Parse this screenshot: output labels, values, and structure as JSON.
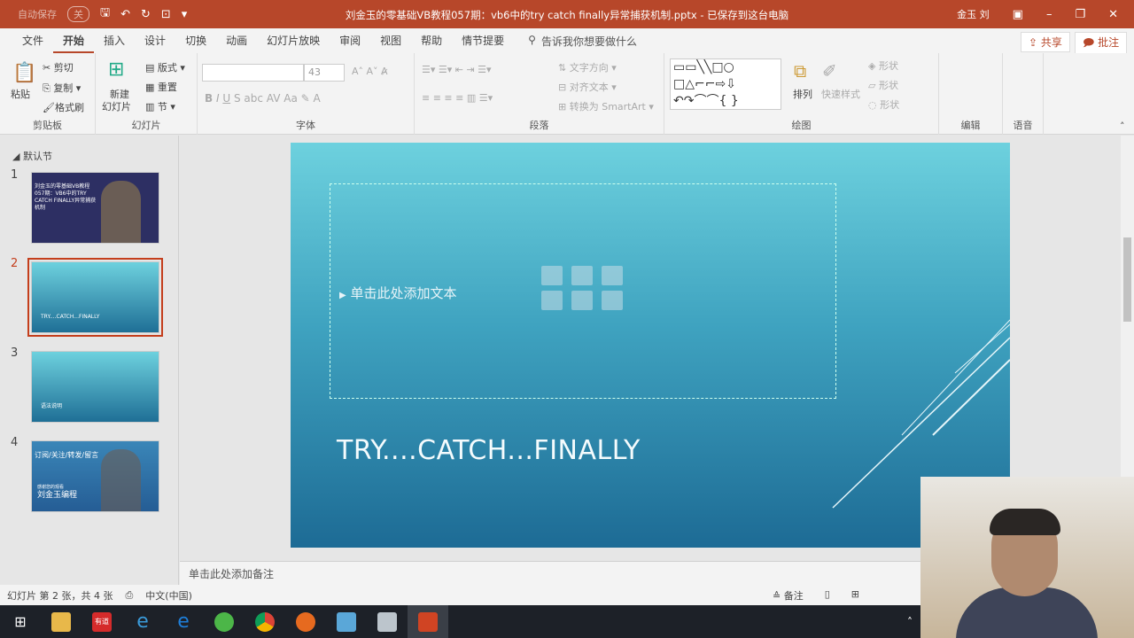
{
  "titlebar": {
    "autosave": "自动保存",
    "autosave_state": "关",
    "title": "刘金玉的零基础VB教程057期：vb6中的try catch finally异常捕获机制.pptx - 已保存到这台电脑",
    "user": "金玉 刘"
  },
  "menu": {
    "tabs": [
      "文件",
      "开始",
      "插入",
      "设计",
      "切换",
      "动画",
      "幻灯片放映",
      "审阅",
      "视图",
      "帮助",
      "情节提要"
    ],
    "active": "开始",
    "tell_me": "告诉我你想要做什么",
    "share": "共享",
    "comments": "批注"
  },
  "ribbon": {
    "clipboard": {
      "label": "剪贴板",
      "paste": "粘贴",
      "cut": "剪切",
      "copy": "复制",
      "format_painter": "格式刷"
    },
    "slides": {
      "label": "幻灯片",
      "new_slide": "新建",
      "new_slide2": "幻灯片",
      "layout": "版式",
      "reset": "重置",
      "section": "节"
    },
    "font": {
      "label": "字体",
      "font_name": "",
      "font_size": "43"
    },
    "paragraph": {
      "label": "段落",
      "text_direction": "文字方向",
      "align_text": "对齐文本",
      "smartart": "转换为 SmartArt"
    },
    "drawing": {
      "label": "绘图",
      "arrange": "排列",
      "quick_styles": "快速样式",
      "shape_fill": "形状",
      "shape_outline": "形状",
      "shape_effects": "形状"
    },
    "editing": {
      "label": "编辑"
    },
    "voice": {
      "label": "语音"
    }
  },
  "slides_pane": {
    "section": "默认节",
    "slides": [
      {
        "num": "1",
        "text": "刘金玉的零基础VB教程057期：VB6中的TRY CATCH FINALLY异常捕获机制"
      },
      {
        "num": "2",
        "text": "TRY....CATCH...FINALLY"
      },
      {
        "num": "3",
        "text": "语法说明"
      },
      {
        "num": "4",
        "text": "订阅/关注/转发/留言",
        "sub": "感谢您的观看",
        "author": "刘金玉编程"
      }
    ],
    "selected": 2
  },
  "slide": {
    "placeholder": "单击此处添加文本",
    "title": "TRY....CATCH...FINALLY"
  },
  "notes": {
    "placeholder": "单击此处添加备注"
  },
  "status": {
    "slide_info": "幻灯片 第 2 张，共 4 张",
    "language": "中文(中国)",
    "notes_button": "备注"
  },
  "taskbar": {
    "apps": [
      "start",
      "file-explorer",
      "youdao",
      "internet-explorer",
      "edge",
      "360-browser",
      "chrome",
      "firefox",
      "remote-desktop",
      "app",
      "powerpoint"
    ],
    "youdao_label": "有道"
  }
}
